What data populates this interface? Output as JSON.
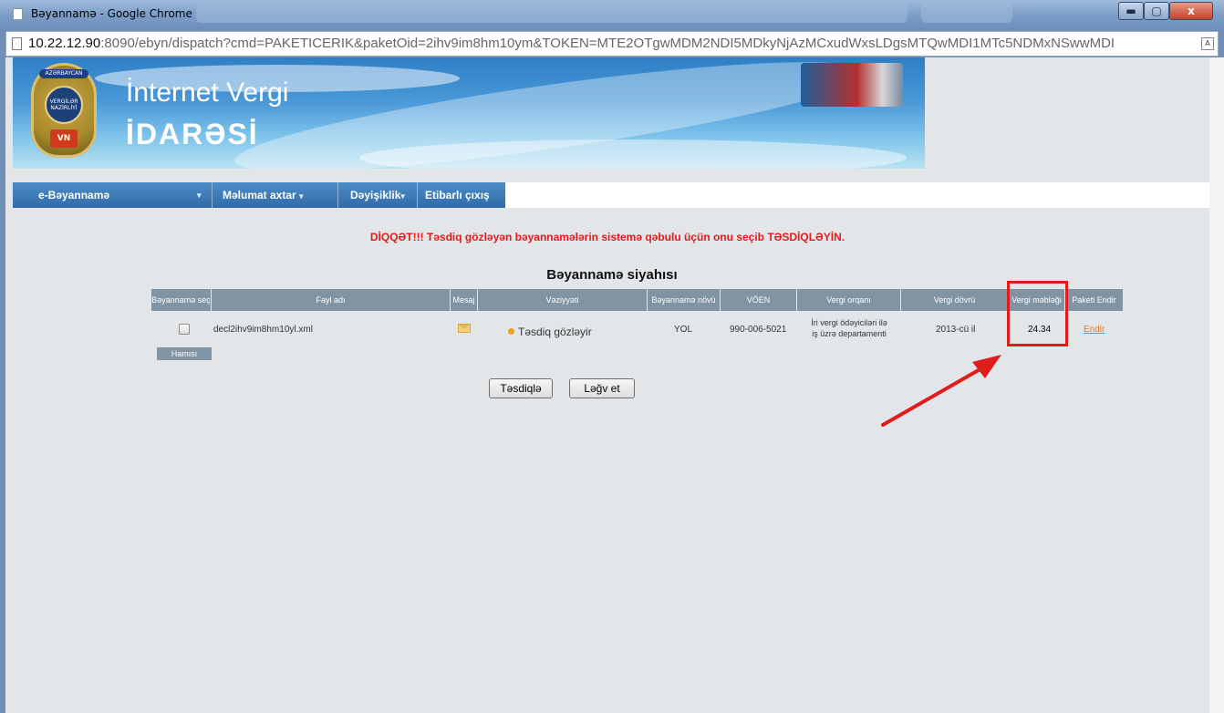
{
  "window": {
    "title": "Bəyannamə - Google Chrome",
    "minimize_glyph": "▬",
    "maximize_glyph": "▢",
    "close_glyph": "x"
  },
  "address": {
    "host": "10.22.12.90",
    "rest": ":8090/ebyn/dispatch?cmd=PAKETICERIK&paketOid=2ihv9im8hm10ym&TOKEN=MTE2OTgwMDM2NDI5MDkyNjAzMCxudWxsLDgsMTQwMDI1MTc5NDMxNSwwMDI",
    "translate_icon": "translate-icon"
  },
  "banner": {
    "brand_line1": "İnternet Vergi",
    "brand_line2": "İDARƏSİ",
    "emblem_top": "AZƏRBAYCAN",
    "emblem_mid": "VERGİLƏR NAZİRLİYİ",
    "emblem_bottom": "VN"
  },
  "nav": {
    "items": [
      {
        "label": "e-Bəyannamə",
        "caret": "▾"
      },
      {
        "label": "Məlumat axtar",
        "caret": "▾"
      },
      {
        "label": "Dəyişiklik",
        "caret": "▾"
      },
      {
        "label": "Etibarlı çıxış",
        "caret": ""
      }
    ]
  },
  "warning": "DİQQƏT!!! Təsdiq gözləyən bəyannamələrin sistemə qəbulu üçün onu seçib TƏSDİQLƏYİN.",
  "list": {
    "title": "Bəyannamə siyahısı",
    "headers": [
      "Bəyannamə seç",
      "Fayl adı",
      "Mesaj",
      "Vəziyyəti",
      "Bəyannamə növü",
      "VÖEN",
      "Vergi orqanı",
      "Vergi dövrü",
      "Vergi məbləği",
      "Paketi Endir"
    ],
    "row": {
      "file": "decl2ihv9im8hm10yl.xml",
      "status": "Təsdiq gözləyir",
      "type": "YOL",
      "voen": "990-006-5021",
      "organ_line1": "İri vergi ödəyiciləri ilə",
      "organ_line2": "iş üzrə departamenti",
      "period": "2013-cü il",
      "amount": "24.34",
      "download": "Endir"
    },
    "select_all": "Hamısı"
  },
  "buttons": {
    "confirm": "Təsdiqlə",
    "cancel": "Ləğv et"
  },
  "colors": {
    "warning": "#e11b1b",
    "highlight": "#e01d1d",
    "nav": "#2f6ba8",
    "grid_header": "#8094a3"
  }
}
